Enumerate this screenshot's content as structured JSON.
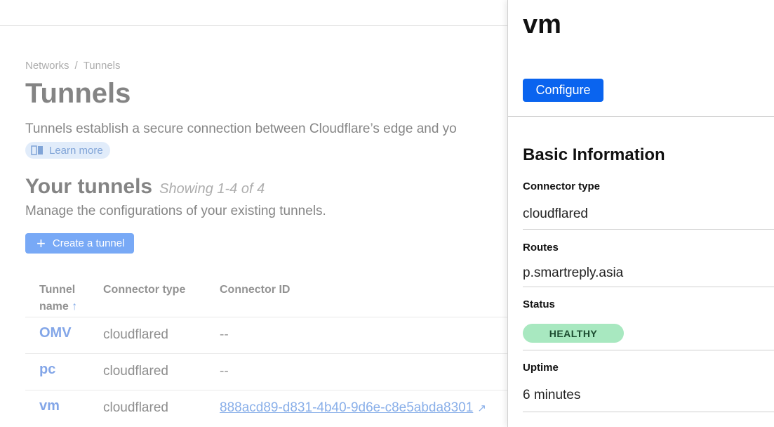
{
  "breadcrumb": {
    "parent": "Networks",
    "separator": "/",
    "current": "Tunnels"
  },
  "page": {
    "title": "Tunnels",
    "description": "Tunnels establish a secure connection between Cloudflare’s edge and yo",
    "learn_more": "Learn more"
  },
  "tunnels_section": {
    "title": "Your tunnels",
    "showing": "Showing 1-4 of 4",
    "description": "Manage the configurations of your existing tunnels.",
    "create_button": "Create a tunnel"
  },
  "table": {
    "headers": {
      "name_line1": "Tunnel",
      "name_line2": "name",
      "sort_indicator": "↑",
      "type": "Connector type",
      "id": "Connector ID"
    },
    "rows": [
      {
        "name": "OMV",
        "type": "cloudflared",
        "id": "--"
      },
      {
        "name": "pc",
        "type": "cloudflared",
        "id": "--"
      },
      {
        "name": "vm",
        "type": "cloudflared",
        "id": "888acd89-d831-4b40-9d6e-c8e5abda8301"
      }
    ]
  },
  "panel": {
    "title": "vm",
    "configure_button": "Configure",
    "section_title": "Basic Information",
    "fields": {
      "connector_type_label": "Connector type",
      "connector_type_value": "cloudflared",
      "routes_label": "Routes",
      "routes_value": "p.smartreply.asia",
      "status_label": "Status",
      "status_value": "HEALTHY",
      "uptime_label": "Uptime",
      "uptime_value": "6 minutes"
    }
  },
  "colors": {
    "accent": "#0a64ef",
    "healthy_badge": "#a8e8c0"
  }
}
